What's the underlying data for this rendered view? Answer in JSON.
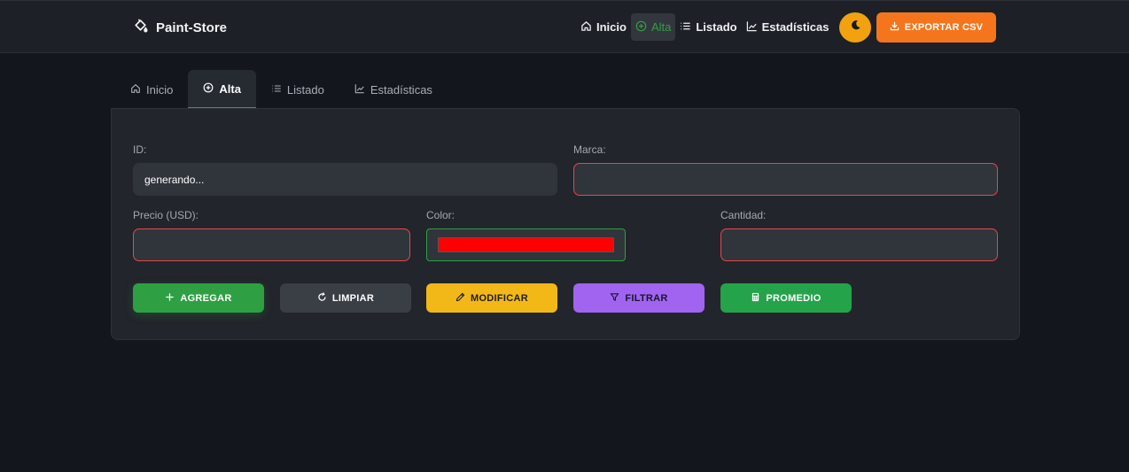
{
  "navbar": {
    "brand": "Paint-Store",
    "items": [
      {
        "label": "Inicio",
        "icon": "home-icon",
        "active": false
      },
      {
        "label": "Alta",
        "icon": "plus-circle-icon",
        "active": true
      },
      {
        "label": "Listado",
        "icon": "list-icon",
        "active": false
      },
      {
        "label": "Estadísticas",
        "icon": "chart-line-icon",
        "active": false
      }
    ],
    "theme_icon": "moon-icon",
    "export_label": "EXPORTAR CSV"
  },
  "tabs": [
    {
      "label": "Inicio",
      "icon": "home-icon",
      "active": false
    },
    {
      "label": "Alta",
      "icon": "plus-circle-icon",
      "active": true
    },
    {
      "label": "Listado",
      "icon": "list-icon",
      "active": false
    },
    {
      "label": "Estadísticas",
      "icon": "chart-line-icon",
      "active": false
    }
  ],
  "form": {
    "id_label": "ID:",
    "id_value": "generando...",
    "marca_label": "Marca:",
    "marca_value": "",
    "precio_label": "Precio (USD):",
    "precio_value": "",
    "color_label": "Color:",
    "color_value": "#ff0000",
    "cantidad_label": "Cantidad:",
    "cantidad_value": ""
  },
  "buttons": {
    "add": "AGREGAR",
    "clear": "LIMPIAR",
    "edit": "MODIFICAR",
    "filter": "FILTRAR",
    "average": "PROMEDIO"
  },
  "colors": {
    "accent_green": "#2ea043",
    "export_orange": "#f5751c",
    "theme_yellow": "#f2a20f",
    "edit_yellow": "#f2b818",
    "filter_purple": "#a064f0",
    "invalid_red": "#e5484d"
  }
}
